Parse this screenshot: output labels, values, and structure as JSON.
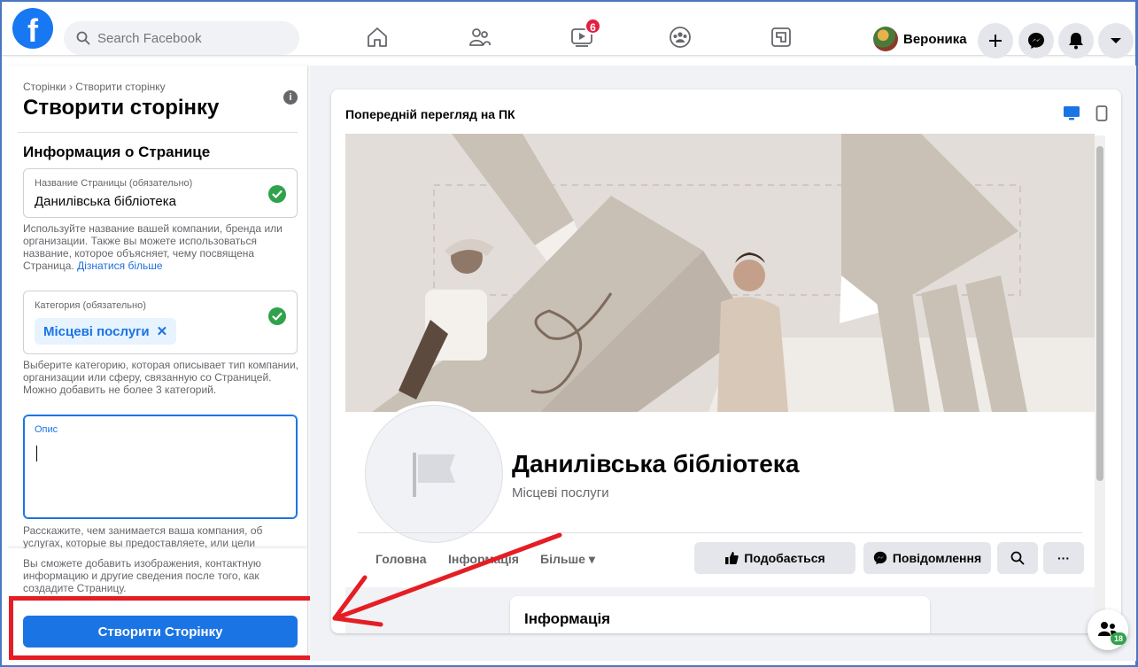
{
  "topbar": {
    "logo": "f",
    "search_placeholder": "Search Facebook",
    "watch_badge": "6",
    "profile_name": "Вероника",
    "icons": [
      "home-icon",
      "friends-icon",
      "watch-icon",
      "groups-icon",
      "gaming-icon",
      "plus-icon",
      "messenger-icon",
      "notifications-icon",
      "account-menu-icon"
    ]
  },
  "left": {
    "breadcrumb": "Сторінки › Створити сторінку",
    "title": "Створити сторінку",
    "section_title": "Информация о Странице",
    "name_field": {
      "label": "Название Страницы (обязательно)",
      "value": "Данилівська бібліотека"
    },
    "name_help": "Используйте название вашей компании, бренда или организации. Также вы можете использоваться название, которое объясняет, чему посвящена Страница.",
    "learn_more": "Дізнатися більше",
    "category_field": {
      "label": "Категория (обязательно)",
      "chip": "Місцеві послуги"
    },
    "category_help": "Выберите категорию, которая описывает тип компании, организации или сферу, связанную со Страницей. Можно добавить не более 3 категорий.",
    "description_field": {
      "label": "Опис",
      "value": ""
    },
    "description_help": "Расскажите, чем занимается ваша компания, об услугах, которые вы предоставляете, или цели",
    "footer_note": "Вы сможете добавить изображения, контактную информацию и другие сведения после того, как создадите Страницу.",
    "create_button": "Створити Сторінку"
  },
  "preview": {
    "title": "Попередній перегляд на ПК",
    "page_name": "Данилівська бібліотека",
    "page_category": "Місцеві послуги",
    "tabs": [
      "Головна",
      "Інформація",
      "Більше"
    ],
    "like_button": "Подобається",
    "message_button": "Повідомлення",
    "info_card_title": "Інформація"
  },
  "fab": {
    "badge": "18"
  },
  "colors": {
    "brand": "#1877f2",
    "button": "#1b74e4",
    "success": "#31a24c",
    "annotation": "#e51d24"
  }
}
